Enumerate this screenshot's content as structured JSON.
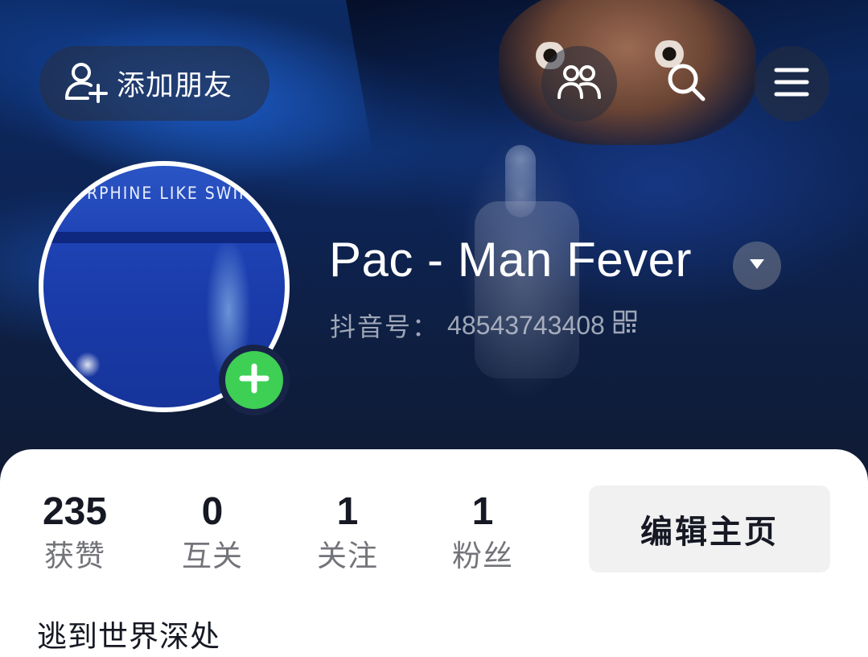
{
  "top_bar": {
    "add_friend_label": "添加朋友",
    "add_friend_icon": "add-user-icon",
    "friends_icon": "friends-icon",
    "search_icon": "search-icon",
    "menu_icon": "hamburger-menu-icon"
  },
  "profile": {
    "avatar_text": "RPHINE LIKE SWIMMI",
    "username": "Pac - Man Fever",
    "douyin_id_label": "抖音号：",
    "douyin_id": "48543743408",
    "qr_icon": "qr-code-icon",
    "bio": "逃到世界深处"
  },
  "stats": [
    {
      "value": "235",
      "label": "获赞"
    },
    {
      "value": "0",
      "label": "互关"
    },
    {
      "value": "1",
      "label": "关注"
    },
    {
      "value": "1",
      "label": "粉丝"
    }
  ],
  "actions": {
    "edit_profile_label": "编辑主页"
  },
  "colors": {
    "accent_green": "#3ecf55",
    "text_primary": "#161823",
    "text_secondary": "#73747a",
    "button_bg": "#f1f1f2"
  }
}
